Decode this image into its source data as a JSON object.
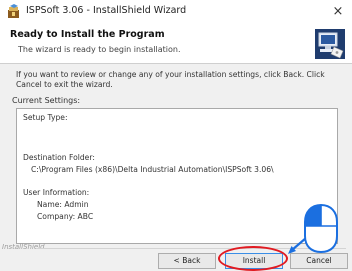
{
  "window": {
    "title": "ISPSoft 3.06 - InstallShield Wizard",
    "close_glyph": "×"
  },
  "header": {
    "title": "Ready to Install the Program",
    "subtitle": "The wizard is ready to begin installation.",
    "graphic": "installer-computer-icon"
  },
  "body": {
    "intro": "If you want to review or change any of your installation settings, click Back. Click Cancel to exit the wizard.",
    "current_settings_label": "Current Settings:"
  },
  "settings": {
    "setup_type_label": "Setup Type:",
    "destination_label": "Destination Folder:",
    "destination_path": "C:\\Program Files (x86)\\Delta Industrial Automation\\ISPSoft 3.06\\",
    "user_info_label": "User Information:",
    "name_line": "Name: Admin",
    "company_line": "Company: ABC"
  },
  "footer": {
    "brand": "InstallShield"
  },
  "buttons": {
    "back": "< Back",
    "install": "Install",
    "cancel": "Cancel"
  },
  "annotations": {
    "highlight_color": "#e11b22",
    "pointer_color": "#1b6fe0",
    "mouse_icon": "mouse-left-click-icon"
  }
}
